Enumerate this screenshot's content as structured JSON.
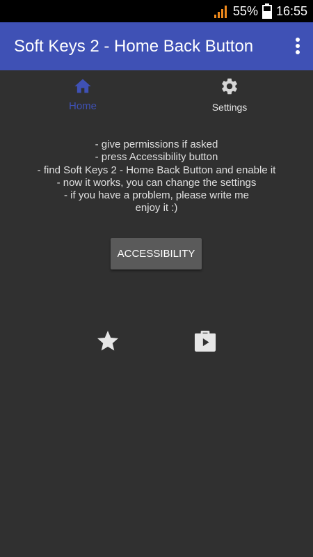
{
  "status_bar": {
    "battery_percent": "55%",
    "time": "16:55",
    "signal_icon": "signal-icon",
    "battery_icon": "battery-icon"
  },
  "app_bar": {
    "title": "Soft Keys 2 - Home Back Button",
    "menu_icon": "more-vert-icon",
    "color": "#3f51b5"
  },
  "tabs": [
    {
      "label": "Home",
      "icon": "home-icon",
      "selected": true,
      "color": "#3f51b5"
    },
    {
      "label": "Settings",
      "icon": "gear-icon",
      "selected": false
    }
  ],
  "instructions": [
    "- give permissions if asked",
    "- press Accessibility button",
    "- find Soft Keys 2 - Home Back Button and enable it",
    "- now it works, you can change the settings",
    "- if you have a problem, please write me",
    "enjoy it :)"
  ],
  "accessibility_button": {
    "label": "ACCESSIBILITY"
  },
  "bottom_icons": [
    {
      "icon": "star-icon"
    },
    {
      "icon": "play-store-icon"
    }
  ]
}
